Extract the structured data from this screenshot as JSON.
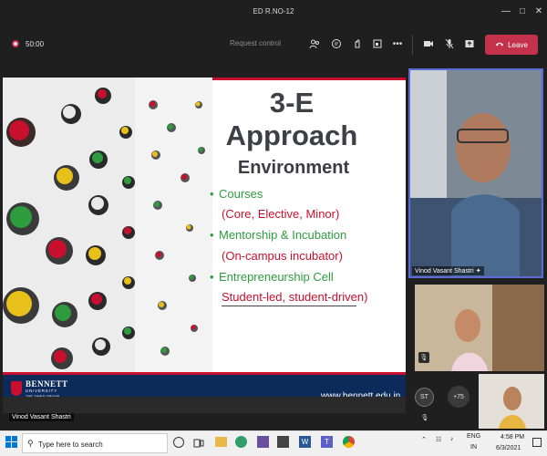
{
  "window": {
    "title": "ED R.NO-12",
    "controls": [
      "minimize-icon",
      "maximize-icon",
      "close-icon"
    ]
  },
  "toolbar": {
    "timer": "50:00",
    "request_control": "Request control",
    "leave_label": "Leave",
    "icons": [
      "participants-icon",
      "chat-icon",
      "reactions-icon",
      "breakout-icon",
      "more-icon",
      "camera-icon",
      "mic-off-icon",
      "share-icon",
      "phone-icon"
    ],
    "leave_color": "#c4314b"
  },
  "slide": {
    "title": "3-E Approach",
    "heading": "Environment",
    "bullets": [
      {
        "label": "Courses",
        "detail": "(Core, Elective, Minor)"
      },
      {
        "label": "Mentorship & Incubation",
        "detail": "(On-campus incubator)"
      },
      {
        "label": "Entrepreneurship Cell",
        "detail": "Student-led, student-driven)"
      }
    ],
    "url": "www.bennett.edu.in",
    "logo": {
      "name": "BENNETT",
      "sub": "UNIVERSITY",
      "group": "THE TIMES GROUP"
    },
    "presenter": "Vinod Vasant Shastri",
    "accent": "#c8102e",
    "bullet_color": "#2e9b3e",
    "footer_color": "#0d2b5a"
  },
  "videos": {
    "main_name": "Vinod Vasant Shastri",
    "avatar_initials": "ST",
    "more_count": "+75"
  },
  "taskbar": {
    "search_placeholder": "Type here to search",
    "lang_top": "ENG",
    "lang_bottom": "IN",
    "time": "4:58 PM",
    "date": "6/3/2021",
    "apps": [
      "task-view-icon",
      "folder-icon",
      "edge-icon",
      "files-icon",
      "store-icon",
      "word-icon",
      "teams-icon",
      "chrome-icon"
    ]
  }
}
